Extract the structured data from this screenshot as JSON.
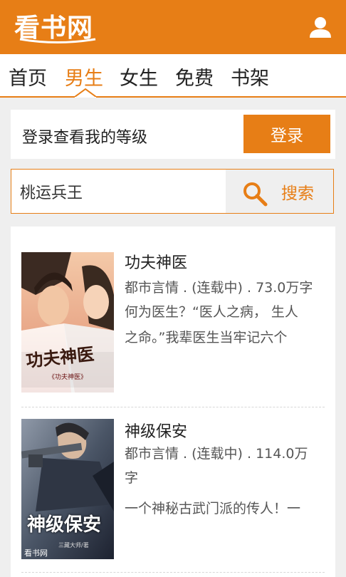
{
  "header": {
    "logo_text": "看书网",
    "brand_color": "#e77e16",
    "user_icon": "user-icon"
  },
  "nav": {
    "items": [
      {
        "label": "首页",
        "active": false
      },
      {
        "label": "男生",
        "active": true
      },
      {
        "label": "女生",
        "active": false
      },
      {
        "label": "免费",
        "active": false
      },
      {
        "label": "书架",
        "active": false
      }
    ]
  },
  "login": {
    "prompt": "登录查看我的等级",
    "button_label": "登录"
  },
  "search": {
    "value": "桃运兵王",
    "button_label": "搜索",
    "icon": "search-icon"
  },
  "books": [
    {
      "title": "功夫神医",
      "meta": "都市言情 . (连载中) . 73.0万字",
      "desc_line1": "何为医生？“医人之病，  生人",
      "desc_line2": "之命。”我辈医生当牢记六个",
      "cover_text": "功夫神医",
      "cover_small": "《功夫神医》"
    },
    {
      "title": "神级保安",
      "meta_line1": "都市言情 . (连载中) . 114.0万",
      "meta_line2": "字",
      "desc_line1": "一个神秘古武门派的传人！一",
      "cover_text": "神级保安",
      "cover_author": "三藏大师/著",
      "cover_logo": "看书网"
    }
  ]
}
